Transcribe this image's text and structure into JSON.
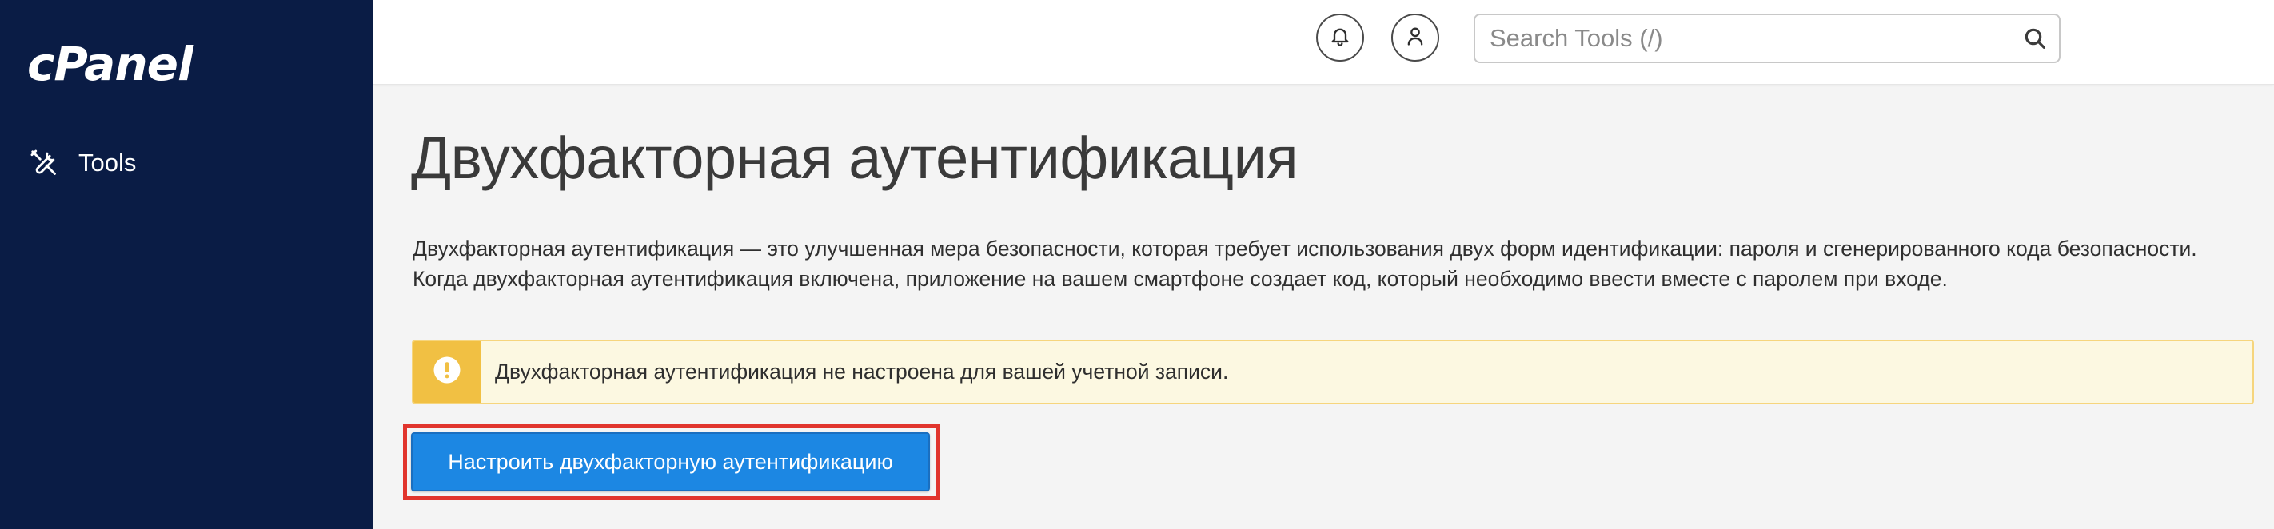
{
  "app": {
    "logo_text": "cPanel"
  },
  "sidebar": {
    "items": [
      {
        "label": "Tools",
        "icon": "tools-icon"
      }
    ]
  },
  "header": {
    "search": {
      "placeholder": "Search Tools (/)",
      "value": "",
      "icon": "search-icon"
    },
    "notifications_icon": "bell-icon",
    "user_icon": "user-icon"
  },
  "main": {
    "title": "Двухфакторная аутентификация",
    "description": "Двухфакторная аутентификация — это улучшенная мера безопасности, которая требует использования двух форм идентификации: пароля и сгенерированного кода безопасности. Когда двухфакторная аутентификация включена, приложение на вашем смартфоне создает код, который необходимо ввести вместе с паролем при входе.",
    "alert": {
      "icon": "exclamation-icon",
      "text": "Двухфакторная аутентификация не настроена для вашей учетной записи."
    },
    "setup_button_label": "Настроить двухфакторную аутентификацию"
  },
  "colors": {
    "sidebar_bg": "#0a1c45",
    "primary_button": "#1c87e3",
    "warning_accent": "#f1c043",
    "warning_bg": "#fcf8e1",
    "highlight_border": "#e1352d"
  }
}
